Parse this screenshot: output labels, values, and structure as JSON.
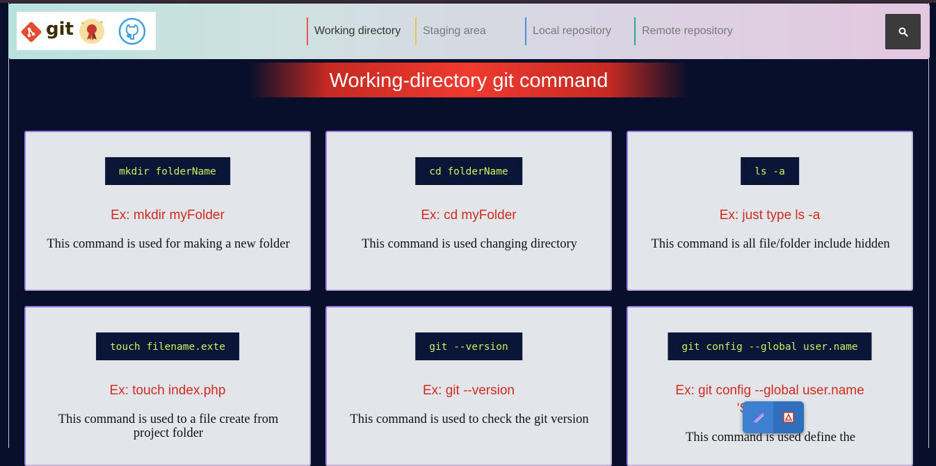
{
  "nav": {
    "logos": {
      "git_text": "git"
    },
    "items": [
      {
        "label": "Working directory",
        "color": "#e05a4e",
        "active": true
      },
      {
        "label": "Staging area",
        "color": "#f0c24b",
        "active": false
      },
      {
        "label": "Local repository",
        "color": "#4a8fd6",
        "active": false
      },
      {
        "label": "Remote repository",
        "color": "#2ea88a",
        "active": false
      }
    ],
    "search_icon": "search-icon"
  },
  "page": {
    "heading": "Working-directory git command"
  },
  "cards": [
    {
      "command": "mkdir folderName",
      "example": "Ex: mkdir myFolder",
      "description": "This command is used for making a new folder"
    },
    {
      "command": "cd folderName",
      "example": "Ex: cd myFolder",
      "description": "This command is used changing directory"
    },
    {
      "command": "ls -a",
      "example": "Ex: just type ls -a",
      "description": "This command is all file/folder include hidden"
    },
    {
      "command": "touch filename.exte",
      "example": "Ex: touch index.php",
      "description": "This command is used to a file create from project folder"
    },
    {
      "command": "git --version",
      "example": "Ex: git --version",
      "description": "This command is used to check the git version"
    },
    {
      "command": "git config --global user.name",
      "example": "Ex: git config --global user.name",
      "example_line2": "'S",
      "example_line2_tail": "n'",
      "description": "This command is used define the"
    }
  ],
  "floating_toolbar": {
    "icons": [
      "pen-icon",
      "pdf-icon"
    ]
  },
  "colors": {
    "background": "#070f2b",
    "command_text": "#c8f35a",
    "example_text": "#d22b1d",
    "heading_bg": "#ef3a2f"
  }
}
